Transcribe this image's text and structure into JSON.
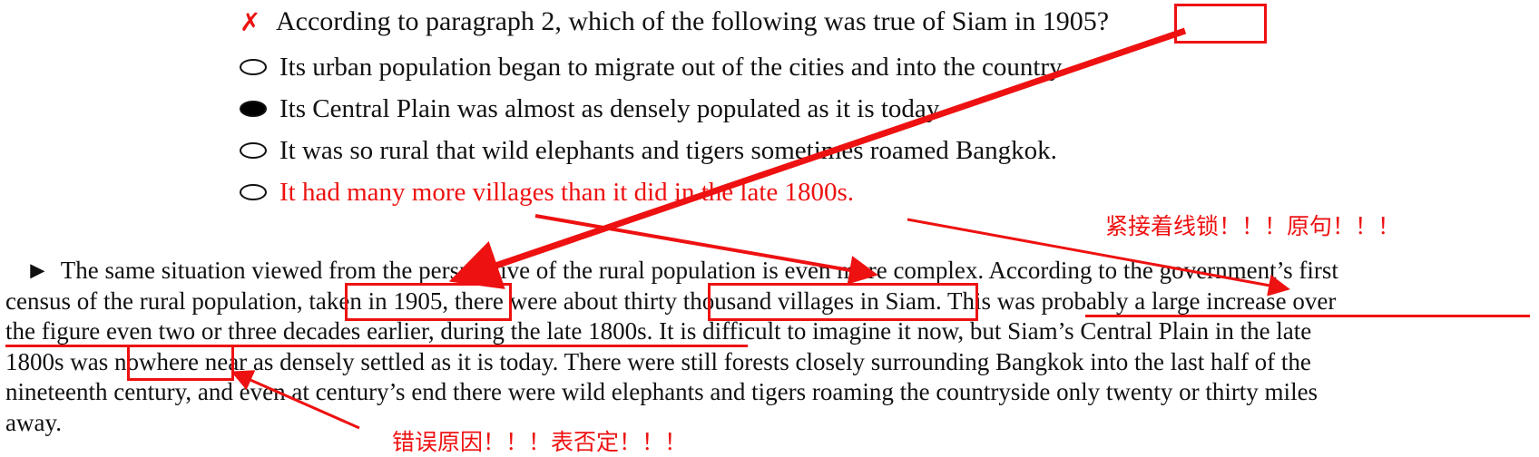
{
  "question": {
    "mark_symbol": "✗",
    "text": "According to paragraph 2, which of the following was true of Siam in 1905?",
    "options": [
      {
        "text": "Its urban population began to migrate out of the cities and into the country.",
        "selected": false
      },
      {
        "text": "Its Central Plain was almost as densely populated as it is today.",
        "selected": true
      },
      {
        "text": "It was so rural that wild elephants and tigers sometimes roamed Bangkok.",
        "selected": false
      },
      {
        "text": "It had many more villages than it did in the late 1800s.",
        "selected": false
      }
    ]
  },
  "passage": {
    "bullet": "►",
    "lines": [
      "The same situation viewed from the perspective of the rural population is even more complex. According to the government’s first",
      "census of the rural population, taken in 1905, there were about thirty thousand villages in Siam. This was probably a large increase over",
      "the figure even two or three decades earlier, during the late 1800s. It is difficult to imagine it now, but Siam’s Central Plain in the late",
      "1800s was nowhere near as densely settled as it is today. There were still forests closely surrounding Bangkok into the last half of the",
      "nineteenth century, and even at century’s end there were wild elephants and tigers roaming the countryside only twenty or thirty miles",
      "away."
    ]
  },
  "annotations": {
    "note_right": "紧接着线锁！！！原句！！！",
    "note_bottom": "错误原因！！！表否定！！！",
    "accent_color": "#e11111"
  }
}
